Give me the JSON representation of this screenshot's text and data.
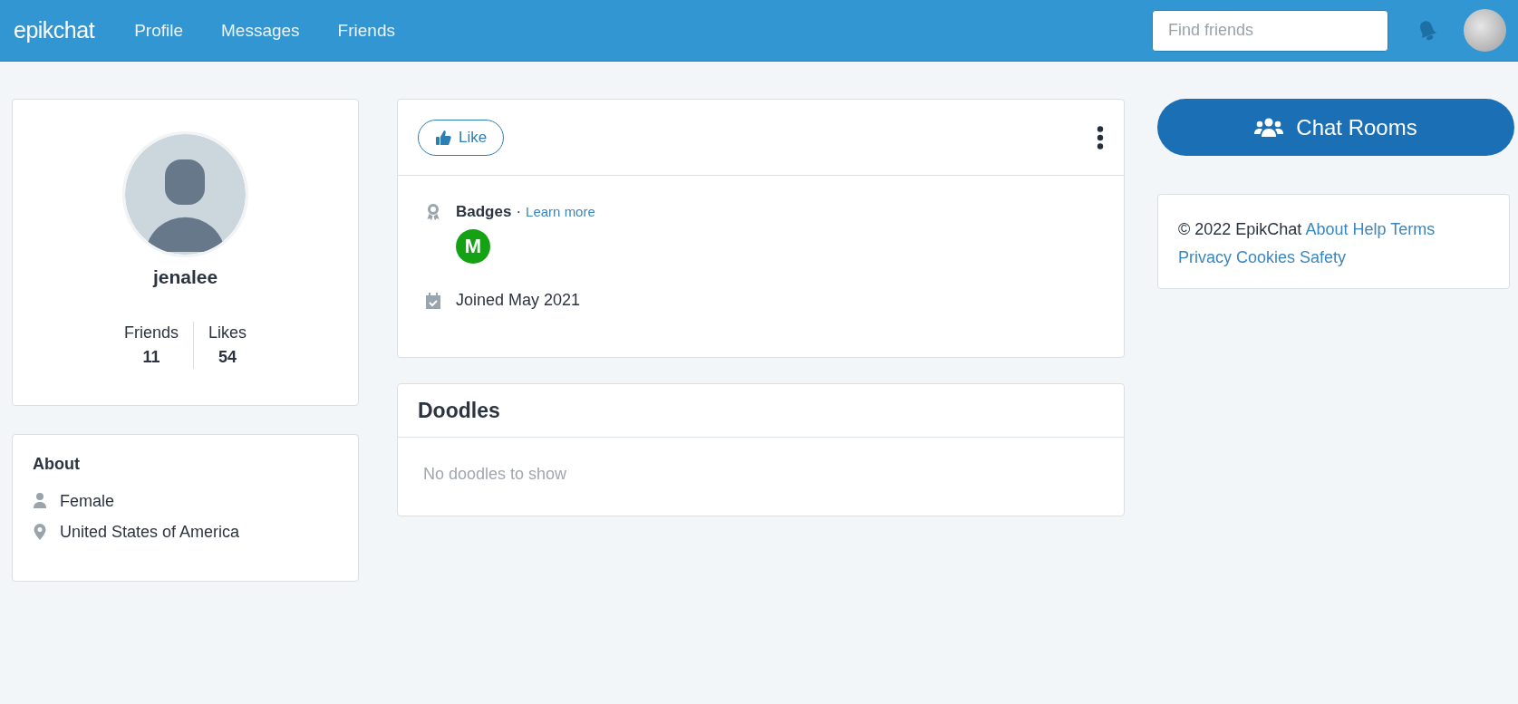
{
  "nav": {
    "logo": "epikchat",
    "links": [
      {
        "label": "Profile"
      },
      {
        "label": "Messages"
      },
      {
        "label": "Friends"
      }
    ],
    "search": {
      "placeholder": "Find friends"
    }
  },
  "profile": {
    "username": "jenalee",
    "stats": [
      {
        "label": "Friends",
        "value": "11"
      },
      {
        "label": "Likes",
        "value": "54"
      }
    ]
  },
  "about": {
    "title": "About",
    "items": [
      {
        "kind": "gender",
        "text": "Female"
      },
      {
        "kind": "location",
        "text": "United States of America"
      }
    ]
  },
  "post": {
    "like_label": "Like",
    "badges_label": "Badges",
    "separator": "·",
    "learn_more": "Learn more",
    "badges": [
      {
        "letter": "M",
        "color": "#14a214"
      }
    ],
    "joined": "Joined May 2021"
  },
  "doodles": {
    "title": "Doodles",
    "empty": "No doodles to show"
  },
  "chat_rooms": {
    "label": "Chat Rooms"
  },
  "footer": {
    "copyright": "© 2022 EpikChat",
    "links": [
      "About",
      "Help",
      "Terms",
      "Privacy",
      "Cookies",
      "Safety"
    ]
  }
}
